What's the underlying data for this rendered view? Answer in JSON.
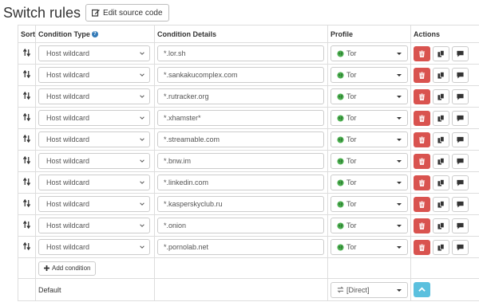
{
  "header": {
    "title": "Switch rules",
    "edit_button": "Edit source code"
  },
  "table": {
    "columns": {
      "sort": "Sort",
      "condition_type": "Condition Type",
      "condition_details": "Condition Details",
      "profile": "Profile",
      "actions": "Actions"
    },
    "rules": [
      {
        "type": "Host wildcard",
        "details": "*.lor.sh",
        "profile": "Tor"
      },
      {
        "type": "Host wildcard",
        "details": "*.sankakucomplex.com",
        "profile": "Tor"
      },
      {
        "type": "Host wildcard",
        "details": "*.rutracker.org",
        "profile": "Tor"
      },
      {
        "type": "Host wildcard",
        "details": "*.xhamster*",
        "profile": "Tor"
      },
      {
        "type": "Host wildcard",
        "details": "*.streamable.com",
        "profile": "Tor"
      },
      {
        "type": "Host wildcard",
        "details": "*.bnw.im",
        "profile": "Tor"
      },
      {
        "type": "Host wildcard",
        "details": "*.linkedin.com",
        "profile": "Tor"
      },
      {
        "type": "Host wildcard",
        "details": "*.kasperskyclub.ru",
        "profile": "Tor"
      },
      {
        "type": "Host wildcard",
        "details": "*.onion",
        "profile": "Tor"
      },
      {
        "type": "Host wildcard",
        "details": "*.pornolab.net",
        "profile": "Tor"
      }
    ],
    "add_condition": "Add condition",
    "default": {
      "label": "Default",
      "profile": "[Direct]"
    }
  },
  "colors": {
    "delete": "#d9534f",
    "up": "#5bc0de",
    "tor_icon": "#4caf50",
    "help": "#337ab7"
  }
}
